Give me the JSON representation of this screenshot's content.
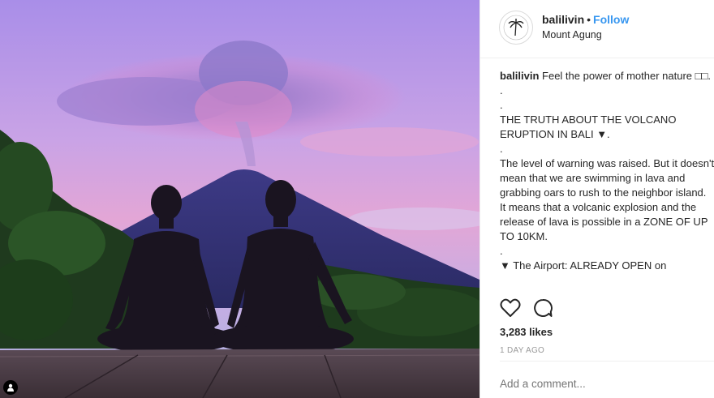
{
  "post": {
    "username": "balilivin",
    "separator": "•",
    "follow_label": "Follow",
    "location": "Mount Agung",
    "caption_text": "Feel the power of mother nature □□.\n.\n.\nTHE TRUTH ABOUT THE VOLCANO ERUPTION IN BALI ▼.\n.\nThe level of warning was raised. But it doesn't mean that we are swimming in lava and grabbing oars to rush to the neighbor island. It means that a volcanic explosion and the release of lava is possible in a ZONE OF UP TO 10KM.\n.\n▼ The Airport: ALREADY OPEN on",
    "likes": "3,283 likes",
    "date": "1 DAY AGO",
    "comment_placeholder": "Add a comment..."
  },
  "icons": {
    "like": "heart-icon",
    "comment": "comment-bubble-icon",
    "tag": "person-tag-icon",
    "avatar_logo": "palm-tree-icon"
  },
  "colors": {
    "follow": "#3897f0",
    "text": "#262626",
    "muted": "#999999",
    "border": "#efefef"
  }
}
